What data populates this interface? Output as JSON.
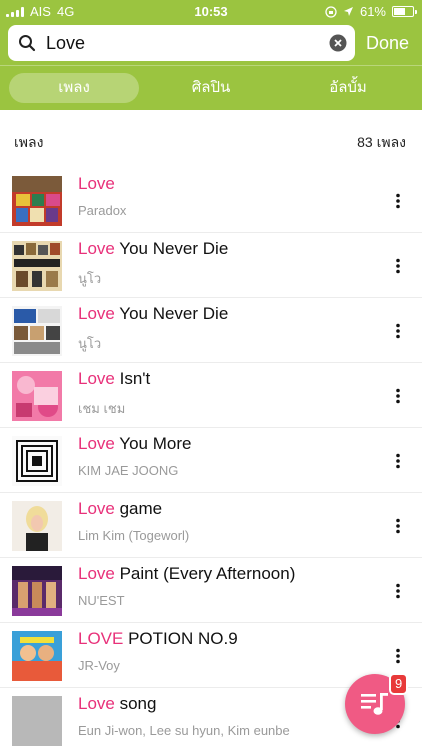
{
  "status_bar": {
    "carrier": "AIS",
    "network": "4G",
    "time": "10:53",
    "battery_text": "61%",
    "battery_level": 0.61
  },
  "search": {
    "value": "Love",
    "done_label": "Done"
  },
  "tabs": [
    {
      "label": "เพลง",
      "active": true
    },
    {
      "label": "ศิลปิน",
      "active": false
    },
    {
      "label": "อัลบั้ม",
      "active": false
    }
  ],
  "section": {
    "title": "เพลง",
    "count": "83 เพลง"
  },
  "songs": [
    {
      "highlight": "Love",
      "rest": "",
      "artist": "Paradox"
    },
    {
      "highlight": "Love",
      "rest": " You Never Die",
      "artist": "นูโว"
    },
    {
      "highlight": "Love",
      "rest": " You Never Die",
      "artist": "นูโว"
    },
    {
      "highlight": "Love",
      "rest": " Isn't",
      "artist": "เชม เชม"
    },
    {
      "highlight": "Love",
      "rest": " You More",
      "artist": "KIM JAE JOONG"
    },
    {
      "highlight": "Love",
      "rest": " game",
      "artist": "Lim Kim (Togeworl)"
    },
    {
      "highlight": "Love",
      "rest": " Paint (Every Afternoon)",
      "artist": "NU'EST"
    },
    {
      "highlight": "LOVE",
      "rest": " POTION NO.9",
      "artist": "JR-Voy"
    },
    {
      "highlight": "Love",
      "rest": " song",
      "artist": "Eun Ji-won, Lee su hyun, Kim eunbe"
    }
  ],
  "queue": {
    "badge_count": "9"
  },
  "colors": {
    "accent_green": "#9bc440",
    "highlight_pink": "#e8317a",
    "fab_pink": "#f05a84",
    "badge_red": "#e83a3a"
  },
  "icons": {
    "search": "search-icon",
    "clear": "clear-icon",
    "more": "more-vertical-icon",
    "queue": "playlist-icon"
  }
}
